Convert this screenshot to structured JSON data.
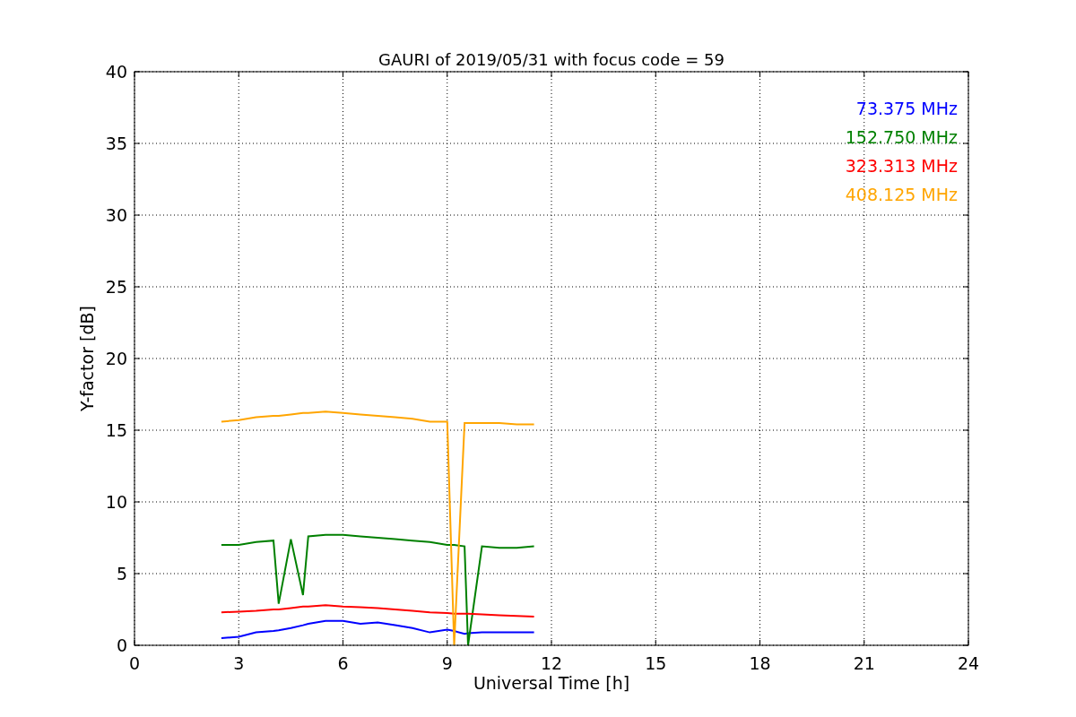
{
  "chart_data": {
    "type": "line",
    "title": "GAURI of 2019/05/31 with focus code = 59",
    "xlabel": "Universal Time [h]",
    "ylabel": "Y-factor [dB]",
    "x": [
      2.5,
      3,
      3.5,
      4,
      4.15,
      4.5,
      4.85,
      5,
      5.5,
      6,
      6.5,
      7,
      7.5,
      8,
      8.5,
      9,
      9.2,
      9.5,
      9.6,
      10,
      10.5,
      11,
      11.5
    ],
    "series": [
      {
        "name": "73.375 MHz",
        "color": "#0000ff",
        "values": [
          0.5,
          0.6,
          0.9,
          1.0,
          1.05,
          1.2,
          1.4,
          1.5,
          1.7,
          1.7,
          1.5,
          1.6,
          1.4,
          1.2,
          0.9,
          1.1,
          1.0,
          0.8,
          0.85,
          0.9,
          0.9,
          0.9,
          0.9
        ]
      },
      {
        "name": "152.750 MHz",
        "color": "#008000",
        "values": [
          7.0,
          7.0,
          7.2,
          7.3,
          2.9,
          7.4,
          3.5,
          7.6,
          7.7,
          7.7,
          7.6,
          7.5,
          7.4,
          7.3,
          7.2,
          7.0,
          7.0,
          6.9,
          0.0,
          6.9,
          6.8,
          6.8,
          6.9
        ]
      },
      {
        "name": "323.313 MHz",
        "color": "#ff0000",
        "values": [
          2.3,
          2.35,
          2.4,
          2.5,
          2.5,
          2.6,
          2.7,
          2.7,
          2.8,
          2.7,
          2.65,
          2.6,
          2.5,
          2.4,
          2.3,
          2.25,
          2.2,
          2.2,
          2.2,
          2.15,
          2.1,
          2.05,
          2.0
        ]
      },
      {
        "name": "408.125 MHz",
        "color": "#ffa500",
        "values": [
          15.6,
          15.7,
          15.9,
          16.0,
          16.0,
          16.1,
          16.2,
          16.2,
          16.3,
          16.2,
          16.1,
          16.0,
          15.9,
          15.8,
          15.6,
          15.6,
          0.0,
          15.5,
          15.5,
          15.5,
          15.5,
          15.4,
          15.4
        ]
      }
    ],
    "xlim": [
      0,
      24
    ],
    "ylim": [
      0,
      40
    ],
    "grid": true,
    "xticks": [
      0,
      3,
      6,
      9,
      12,
      15,
      18,
      21,
      24
    ],
    "yticks": [
      0,
      5,
      10,
      15,
      20,
      25,
      30,
      35,
      40
    ]
  }
}
